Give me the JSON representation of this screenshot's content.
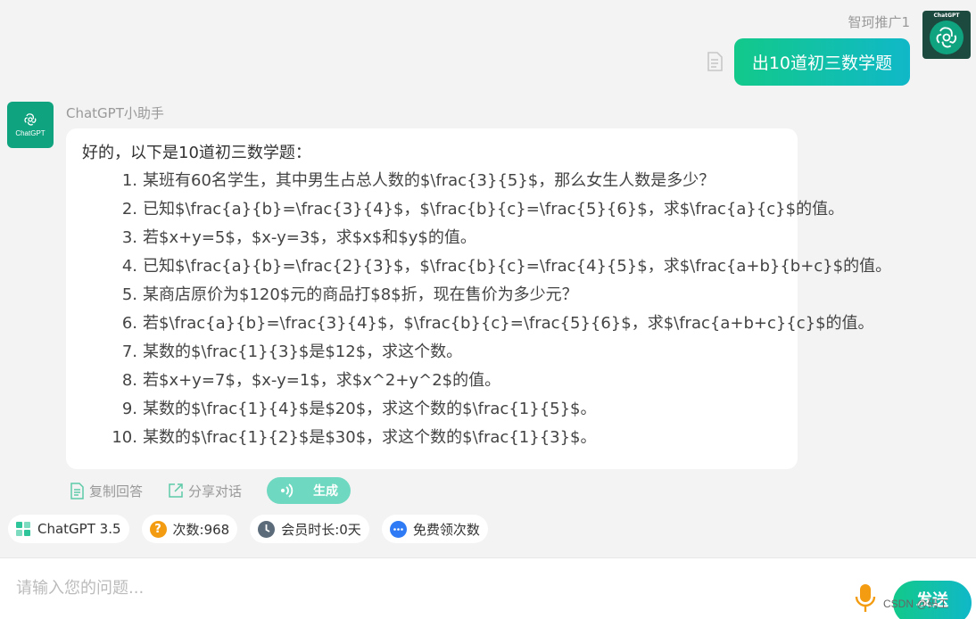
{
  "user": {
    "name": "智珂推广1",
    "avatar_label": "ChatGPT",
    "message": "出10道初三数学题"
  },
  "bot": {
    "name": "ChatGPT小助手",
    "avatar_label": "ChatGPT",
    "intro": "好的，以下是10道初三数学题：",
    "questions": [
      {
        "num": "1.",
        "text": "某班有60名学生，其中男生占总人数的$\\frac{3}{5}$，那么女生人数是多少？"
      },
      {
        "num": "2.",
        "text": "已知$\\frac{a}{b}=\\frac{3}{4}$，$\\frac{b}{c}=\\frac{5}{6}$，求$\\frac{a}{c}$的值。"
      },
      {
        "num": "3.",
        "text": "若$x+y=5$，$x-y=3$，求$x$和$y$的值。"
      },
      {
        "num": "4.",
        "text": "已知$\\frac{a}{b}=\\frac{2}{3}$，$\\frac{b}{c}=\\frac{4}{5}$，求$\\frac{a+b}{b+c}$的值。"
      },
      {
        "num": "5.",
        "text": "某商店原价为$120$元的商品打$8$折，现在售价为多少元？"
      },
      {
        "num": "6.",
        "text": "若$\\frac{a}{b}=\\frac{3}{4}$，$\\frac{b}{c}=\\frac{5}{6}$，求$\\frac{a+b+c}{c}$的值。"
      },
      {
        "num": "7.",
        "text": "某数的$\\frac{1}{3}$是$12$，求这个数。"
      },
      {
        "num": "8.",
        "text": "若$x+y=7$，$x-y=1$，求$x^2+y^2$的值。"
      },
      {
        "num": "9.",
        "text": "某数的$\\frac{1}{4}$是$20$，求这个数的$\\frac{1}{5}$。"
      },
      {
        "num": "10.",
        "text": "某数的$\\frac{1}{2}$是$30$，求这个数的$\\frac{1}{3}$。"
      }
    ]
  },
  "actions": {
    "copy_label": "复制回答",
    "share_label": "分享对话",
    "generate_label": "生成"
  },
  "chips": {
    "model": "ChatGPT 3.5",
    "count": "次数:968",
    "membership": "会员时长:0天",
    "free": "免费领次数"
  },
  "input": {
    "placeholder": "请输入您的问题..."
  },
  "send_label": "发送",
  "watermark": "CSDN @码工",
  "colors": {
    "accent_green": "#13c98a",
    "accent_teal": "#10b8c8",
    "brand": "#10a37f",
    "count_icon": "#f39c12",
    "clock_icon": "#5b6b7a",
    "free_icon": "#2f7bf5"
  }
}
